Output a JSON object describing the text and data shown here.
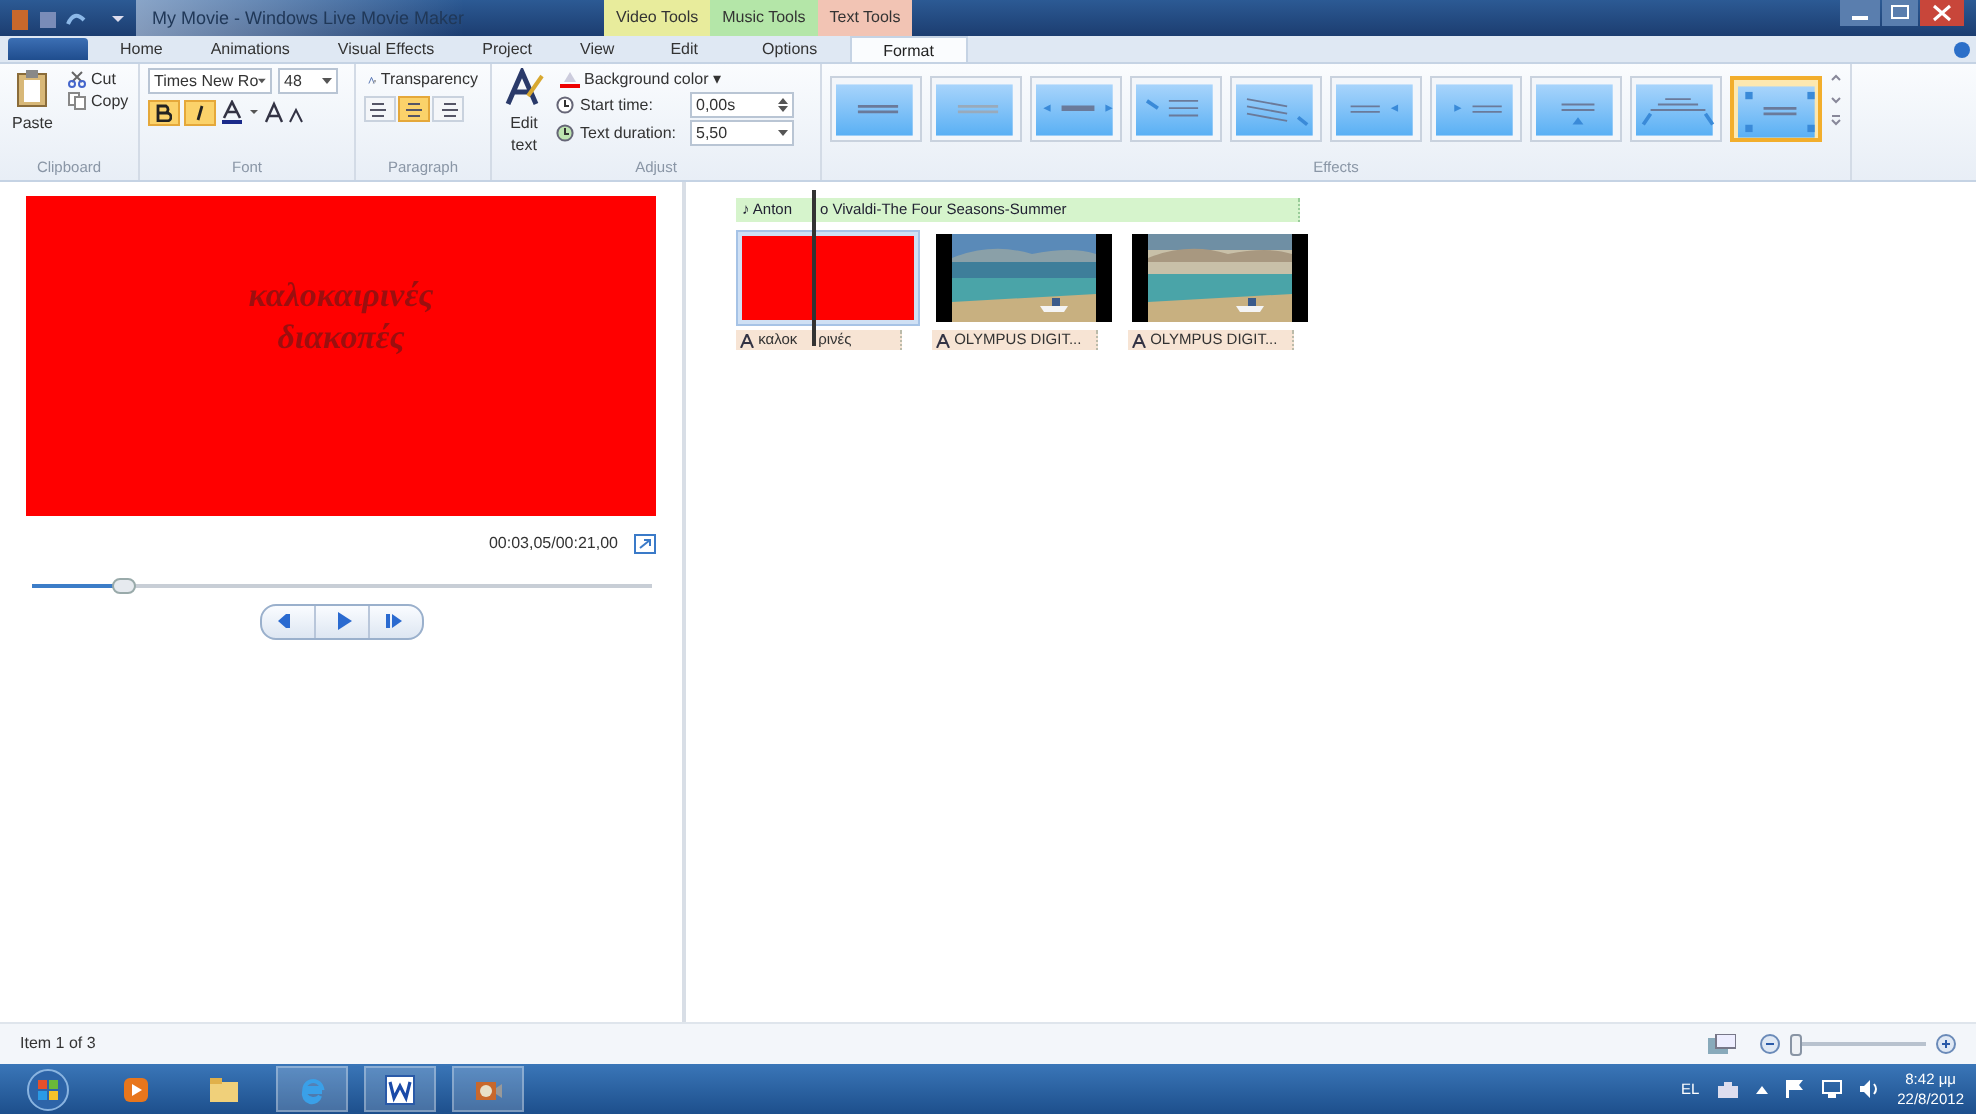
{
  "window": {
    "title": "My Movie - Windows Live Movie Maker"
  },
  "tool_groups": [
    {
      "label": "Video Tools",
      "color": "#e8ec9c"
    },
    {
      "label": "Music Tools",
      "color": "#b4e6a8"
    },
    {
      "label": "Text Tools",
      "color": "#f2c4b4"
    }
  ],
  "tabs": [
    {
      "label": "Home",
      "selected": false
    },
    {
      "label": "Animations",
      "selected": false
    },
    {
      "label": "Visual Effects",
      "selected": false
    },
    {
      "label": "Project",
      "selected": false
    },
    {
      "label": "View",
      "selected": false
    },
    {
      "label": "Edit",
      "selected": false
    },
    {
      "label": "Options",
      "selected": false
    },
    {
      "label": "Format",
      "selected": true
    }
  ],
  "clipboard": {
    "paste": "Paste",
    "cut": "Cut",
    "copy": "Copy",
    "label": "Clipboard"
  },
  "font": {
    "family": "Times New Ro",
    "size": "48",
    "bold": true,
    "italic": true,
    "label": "Font"
  },
  "paragraph": {
    "transparency": "Transparency",
    "align": [
      {
        "selected": false
      },
      {
        "selected": true
      },
      {
        "selected": false
      }
    ],
    "label": "Paragraph"
  },
  "adjust": {
    "edit_text": "Edit text",
    "background_color": "Background color ▾",
    "start_time_label": "Start time:",
    "start_time": "0,00s",
    "duration_label": "Text duration:",
    "duration": "5,50",
    "label": "Adjust"
  },
  "effects": {
    "label": "Effects",
    "items": [
      {
        "selected": false
      },
      {
        "selected": false
      },
      {
        "selected": false
      },
      {
        "selected": false
      },
      {
        "selected": false
      },
      {
        "selected": false
      },
      {
        "selected": false
      },
      {
        "selected": false
      },
      {
        "selected": false
      },
      {
        "selected": true
      }
    ]
  },
  "preview": {
    "text": "καλοκαιρινές διακοπές",
    "time": "00:03,05/00:21,00",
    "level": 0.15
  },
  "storyboard": {
    "music": [
      "♪ Anton",
      "o Vivaldi-The Four Seasons-Summer"
    ],
    "clips": [
      {
        "kind": "title",
        "caption": [
          "καλοκ",
          "ρινές"
        ],
        "selected": true
      },
      {
        "caption": "OLYMPUS DIGIT...",
        "selected": false
      },
      {
        "caption": "OLYMPUS DIGIT...",
        "selected": false
      }
    ]
  },
  "status_bar": {
    "text": "Item 1 of 3",
    "zoom": {
      "level": 0.05
    }
  },
  "taskbar": {
    "language": "EL",
    "time": "8:42 μμ",
    "date": "22/8/2012"
  }
}
